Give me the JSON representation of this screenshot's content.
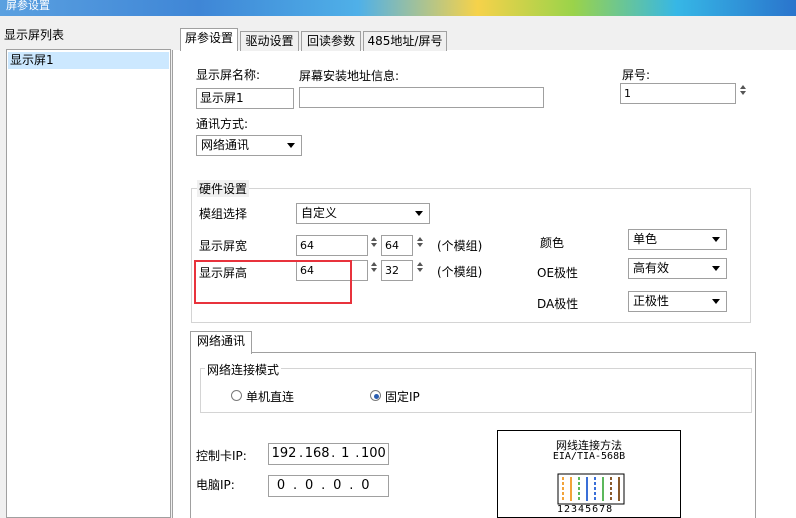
{
  "window": {
    "title": "屏参设置"
  },
  "left": {
    "header": "显示屏列表",
    "items": [
      "显示屏1"
    ]
  },
  "tabs": [
    "屏参设置",
    "驱动设置",
    "回读参数",
    "485地址/屏号"
  ],
  "screen": {
    "name_label": "显示屏名称:",
    "name_value": "显示屏1",
    "addr_label": "屏幕安装地址信息:",
    "addr_value": "",
    "num_label": "屏号:",
    "num_value": "1",
    "comm_label": "通讯方式:",
    "comm_value": "网络通讯"
  },
  "hardware": {
    "title": "硬件设置",
    "module_label": "模组选择",
    "module_value": "自定义",
    "width_label": "显示屏宽",
    "width_value": "64",
    "width_modules": "64",
    "height_label": "显示屏高",
    "height_value": "64",
    "height_modules": "32",
    "unit_label": "(个模组)",
    "color_label": "颜色",
    "color_value": "单色",
    "oe_label": "OE极性",
    "oe_value": "高有效",
    "da_label": "DA极性",
    "da_value": "正极性"
  },
  "network": {
    "tab": "网络通讯",
    "mode_title": "网络连接模式",
    "radio_direct": "单机直连",
    "radio_fixed": "固定IP",
    "card_ip_label": "控制卡IP:",
    "card_ip": [
      "192",
      "168",
      "1",
      "100"
    ],
    "pc_ip_label": "电脑IP:",
    "pc_ip": [
      "0",
      "0",
      "0",
      "0"
    ],
    "diagram_title": "网线连接方法",
    "diagram_subtitle": "EIA/TIA-568B",
    "pins": "12345678"
  },
  "colors": {
    "selection": "#cce8ff",
    "highlight": "#e8323c"
  }
}
